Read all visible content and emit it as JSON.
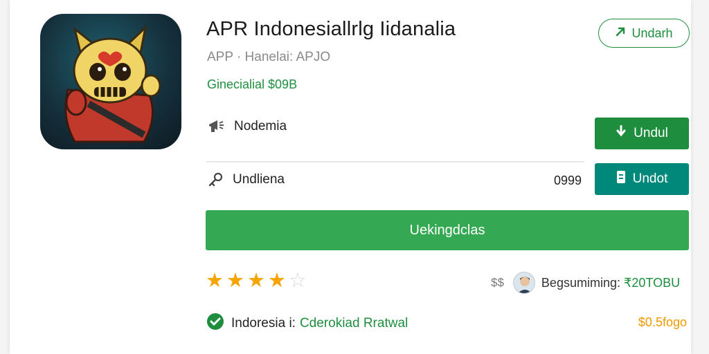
{
  "app": {
    "title": "APR Indonesiallrlg Iidanalia",
    "subtitle": "APP · Hanelai: APJO",
    "price_line": "Ginecialial $09B"
  },
  "header_button": {
    "label": "Undarh",
    "icon": "download-arrow-icon"
  },
  "rows": [
    {
      "label": "Nodemia",
      "icon": "megaphone-icon"
    },
    {
      "label": "Undliena",
      "icon": "key-icon",
      "value": "0999"
    }
  ],
  "buttons": {
    "primary": {
      "label": "Undul",
      "icon": "download-arrow-icon"
    },
    "secondary": {
      "label": "Undot",
      "icon": "document-icon"
    },
    "wide": {
      "label": "Uekingdclas"
    }
  },
  "rating": {
    "value": 4,
    "max": 5
  },
  "developer": {
    "currency": "$$",
    "label": "Begsumiming:",
    "value": "₹20TOBU"
  },
  "verified": {
    "label": "Indoresia i:",
    "value": "Cderokiad Rratwal",
    "price": "$0.5fogo"
  },
  "colors": {
    "green": "#1e8e3e",
    "light_green": "#34a853",
    "teal": "#00897b",
    "star": "#f6a500",
    "price_orange": "#f29900"
  }
}
